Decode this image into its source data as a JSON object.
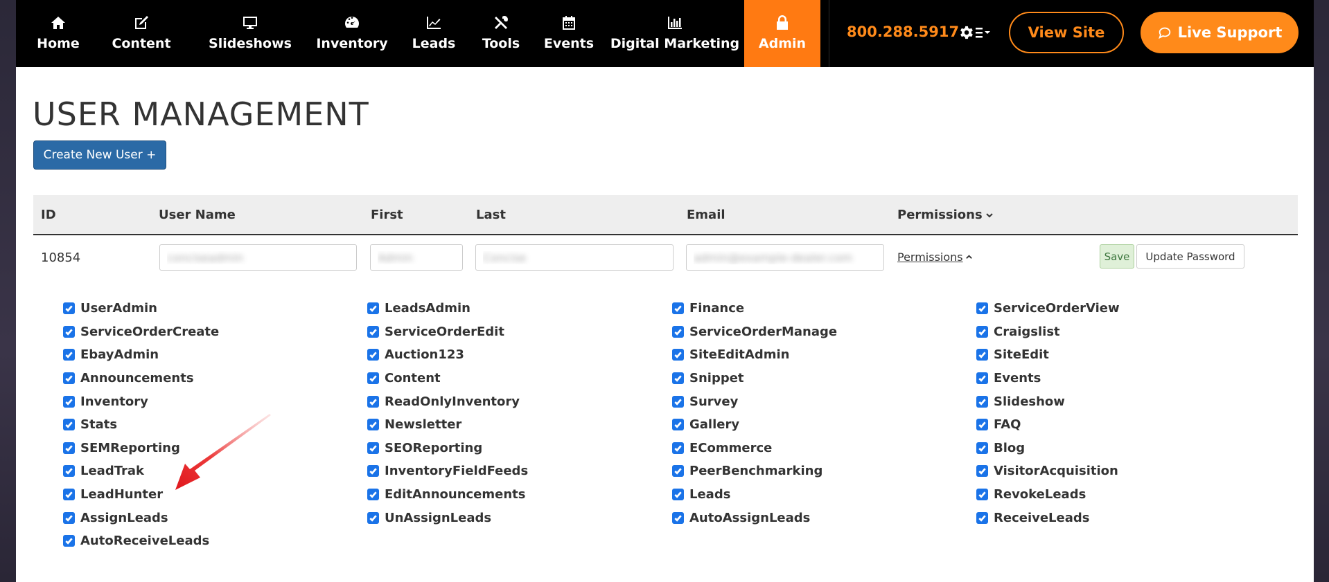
{
  "nav": {
    "items": [
      {
        "label": "Home",
        "icon": "home-icon"
      },
      {
        "label": "Content",
        "icon": "edit-icon"
      },
      {
        "label": "Slideshows",
        "icon": "monitor-icon"
      },
      {
        "label": "Inventory",
        "icon": "gauge-icon"
      },
      {
        "label": "Leads",
        "icon": "chart-line-icon"
      },
      {
        "label": "Tools",
        "icon": "tools-icon"
      },
      {
        "label": "Events",
        "icon": "calendar-icon"
      },
      {
        "label": "Digital Marketing",
        "icon": "bar-chart-icon"
      },
      {
        "label": "Admin",
        "icon": "lock-icon"
      }
    ],
    "active": "Admin",
    "phone": "800.288.5917",
    "view_site": "View Site",
    "live_support": "Live Support"
  },
  "page": {
    "title": "USER MANAGEMENT",
    "create_button": "Create New User +"
  },
  "table": {
    "headers": {
      "id": "ID",
      "username": "User Name",
      "first": "First",
      "last": "Last",
      "email": "Email",
      "permissions": "Permissions"
    },
    "row": {
      "id": "10854",
      "username": "conciseadmin",
      "first": "Admin",
      "last": "Concise",
      "email": "admin@example-dealer.com",
      "permissions_link": "Permissions",
      "save": "Save",
      "update_password": "Update Password"
    }
  },
  "permissions": {
    "columns": [
      [
        "UserAdmin",
        "ServiceOrderCreate",
        "EbayAdmin",
        "Announcements",
        "Inventory",
        "Stats",
        "SEMReporting",
        "LeadTrak",
        "LeadHunter",
        "AssignLeads",
        "AutoReceiveLeads"
      ],
      [
        "LeadsAdmin",
        "ServiceOrderEdit",
        "Auction123",
        "Content",
        "ReadOnlyInventory",
        "Newsletter",
        "SEOReporting",
        "InventoryFieldFeeds",
        "EditAnnouncements",
        "UnAssignLeads"
      ],
      [
        "Finance",
        "ServiceOrderManage",
        "SiteEditAdmin",
        "Snippet",
        "Survey",
        "Gallery",
        "ECommerce",
        "PeerBenchmarking",
        "Leads",
        "AutoAssignLeads"
      ],
      [
        "ServiceOrderView",
        "Craigslist",
        "SiteEdit",
        "Events",
        "Slideshow",
        "FAQ",
        "Blog",
        "VisitorAcquisition",
        "RevokeLeads",
        "ReceiveLeads"
      ]
    ],
    "checked": true
  },
  "colors": {
    "accent": "#ff8a1a",
    "nav_bg": "#000000",
    "primary_button": "#2b6aa6",
    "checkbox": "#1a73e8",
    "annotation_arrow": "#e8262b"
  }
}
